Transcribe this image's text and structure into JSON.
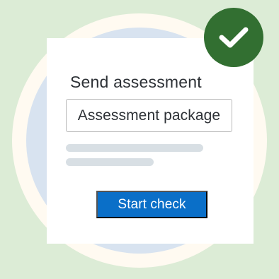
{
  "card": {
    "title": "Send assessment",
    "field_value": "Assessment package",
    "button_label": "Start check"
  },
  "colors": {
    "background": "#dcecd6",
    "circle_outer": "#fffaf1",
    "circle_inner": "#d8e3f0",
    "card": "#ffffff",
    "button": "#0a6fc8",
    "badge": "#326f31"
  },
  "icons": {
    "badge": "checkmark-icon"
  }
}
